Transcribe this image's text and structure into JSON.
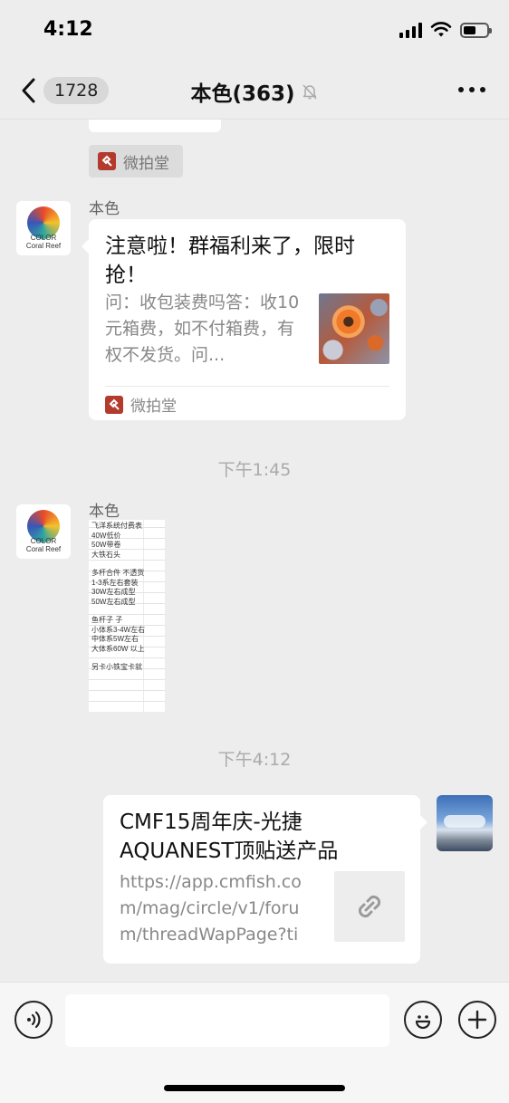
{
  "status_bar": {
    "time": "4:12"
  },
  "nav": {
    "unread_count": "1728",
    "title": "本色(363)"
  },
  "messages": {
    "prev_card_source": "微拍堂",
    "msg1": {
      "sender": "本色",
      "title": "注意啦！群福利来了，限时抢！",
      "description": "问：收包装费吗答：收10元箱费，如不付箱费，有权不发货。问...",
      "source": "微拍堂"
    },
    "timestamp1": "下午1:45",
    "msg2": {
      "sender": "本色",
      "doc_lines": [
        "飞洋系统付费表",
        "40W低价",
        "50W带卷",
        "大铁石头",
        "",
        "多杆合件 不透货",
        "1-3系左右套装",
        "30W左右成型",
        "50W左右成型",
        "",
        "鱼杆子 子",
        "小体系3-4W左右",
        "中体系5W左右",
        "大体系60W 以上",
        "",
        "另卡小铁宝卡就"
      ]
    },
    "timestamp2": "下午4:12",
    "msg3": {
      "title": "CMF15周年庆-光捷AQUANEST顶贴送产品",
      "description": "https://app.cmfish.com/mag/circle/v1/forum/threadWapPage?tid..."
    }
  },
  "avatar_brand": {
    "line1": "COLOR",
    "line2": "Coral Reef"
  },
  "icons": {
    "back": "chevron-left-icon",
    "mute": "bell-slash-icon",
    "more": "ellipsis-icon",
    "voice": "voice-icon",
    "emoji": "emoji-icon",
    "add": "plus-icon",
    "link": "link-icon"
  },
  "colors": {
    "background": "#ededed",
    "card": "#ffffff",
    "source_brand": "#b33a2c"
  }
}
